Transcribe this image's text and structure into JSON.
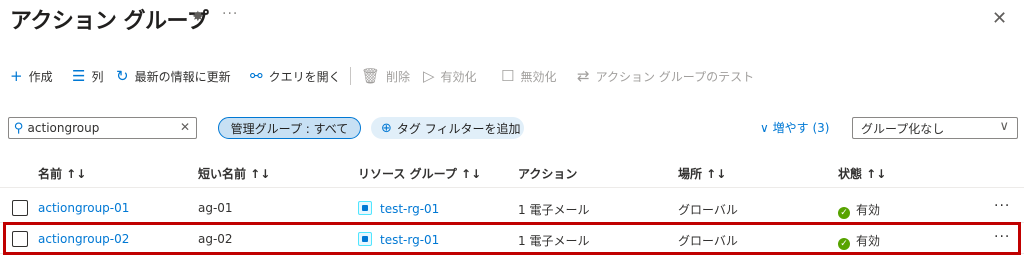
{
  "header": {
    "title": "アクション グループ"
  },
  "toolbar": {
    "create": "作成",
    "columns": "列",
    "refresh": "最新の情報に更新",
    "query": "クエリを開く",
    "delete": "削除",
    "enable": "有効化",
    "disable": "無効化",
    "test": "アクション グループのテスト"
  },
  "filters": {
    "search_value": "actiongroup",
    "scope_pill": "管理グループ : すべて",
    "add_tag": "タグ フィルターを追加",
    "expand": "増やす (3)",
    "grouping": "グループ化なし"
  },
  "table": {
    "columns": {
      "name": "名前 ↑↓",
      "short_name": "短い名前 ↑↓",
      "resource_group": "リソース グループ ↑↓",
      "action": "アクション",
      "location": "場所 ↑↓",
      "status": "状態 ↑↓"
    },
    "rows": [
      {
        "name": "actiongroup-01",
        "short_name": "ag-01",
        "resource_group": "test-rg-01",
        "action": "1 電子メール",
        "location": "グローバル",
        "status": "有効"
      },
      {
        "name": "actiongroup-02",
        "short_name": "ag-02",
        "resource_group": "test-rg-01",
        "action": "1 電子メール",
        "location": "グローバル",
        "status": "有効"
      }
    ]
  },
  "colors": {
    "accent": "#0078d4",
    "success": "#57a300",
    "highlight": "#c00000"
  },
  "icons": [
    "pin-icon",
    "close-icon",
    "plus-icon",
    "columns-icon",
    "refresh-icon",
    "query-icon",
    "delete-icon",
    "play-icon",
    "checkbox-icon",
    "swap-icon",
    "search-icon",
    "tag-filter-icon",
    "chevron-down-icon",
    "resource-group-icon",
    "check-circle-icon",
    "more-icon"
  ]
}
